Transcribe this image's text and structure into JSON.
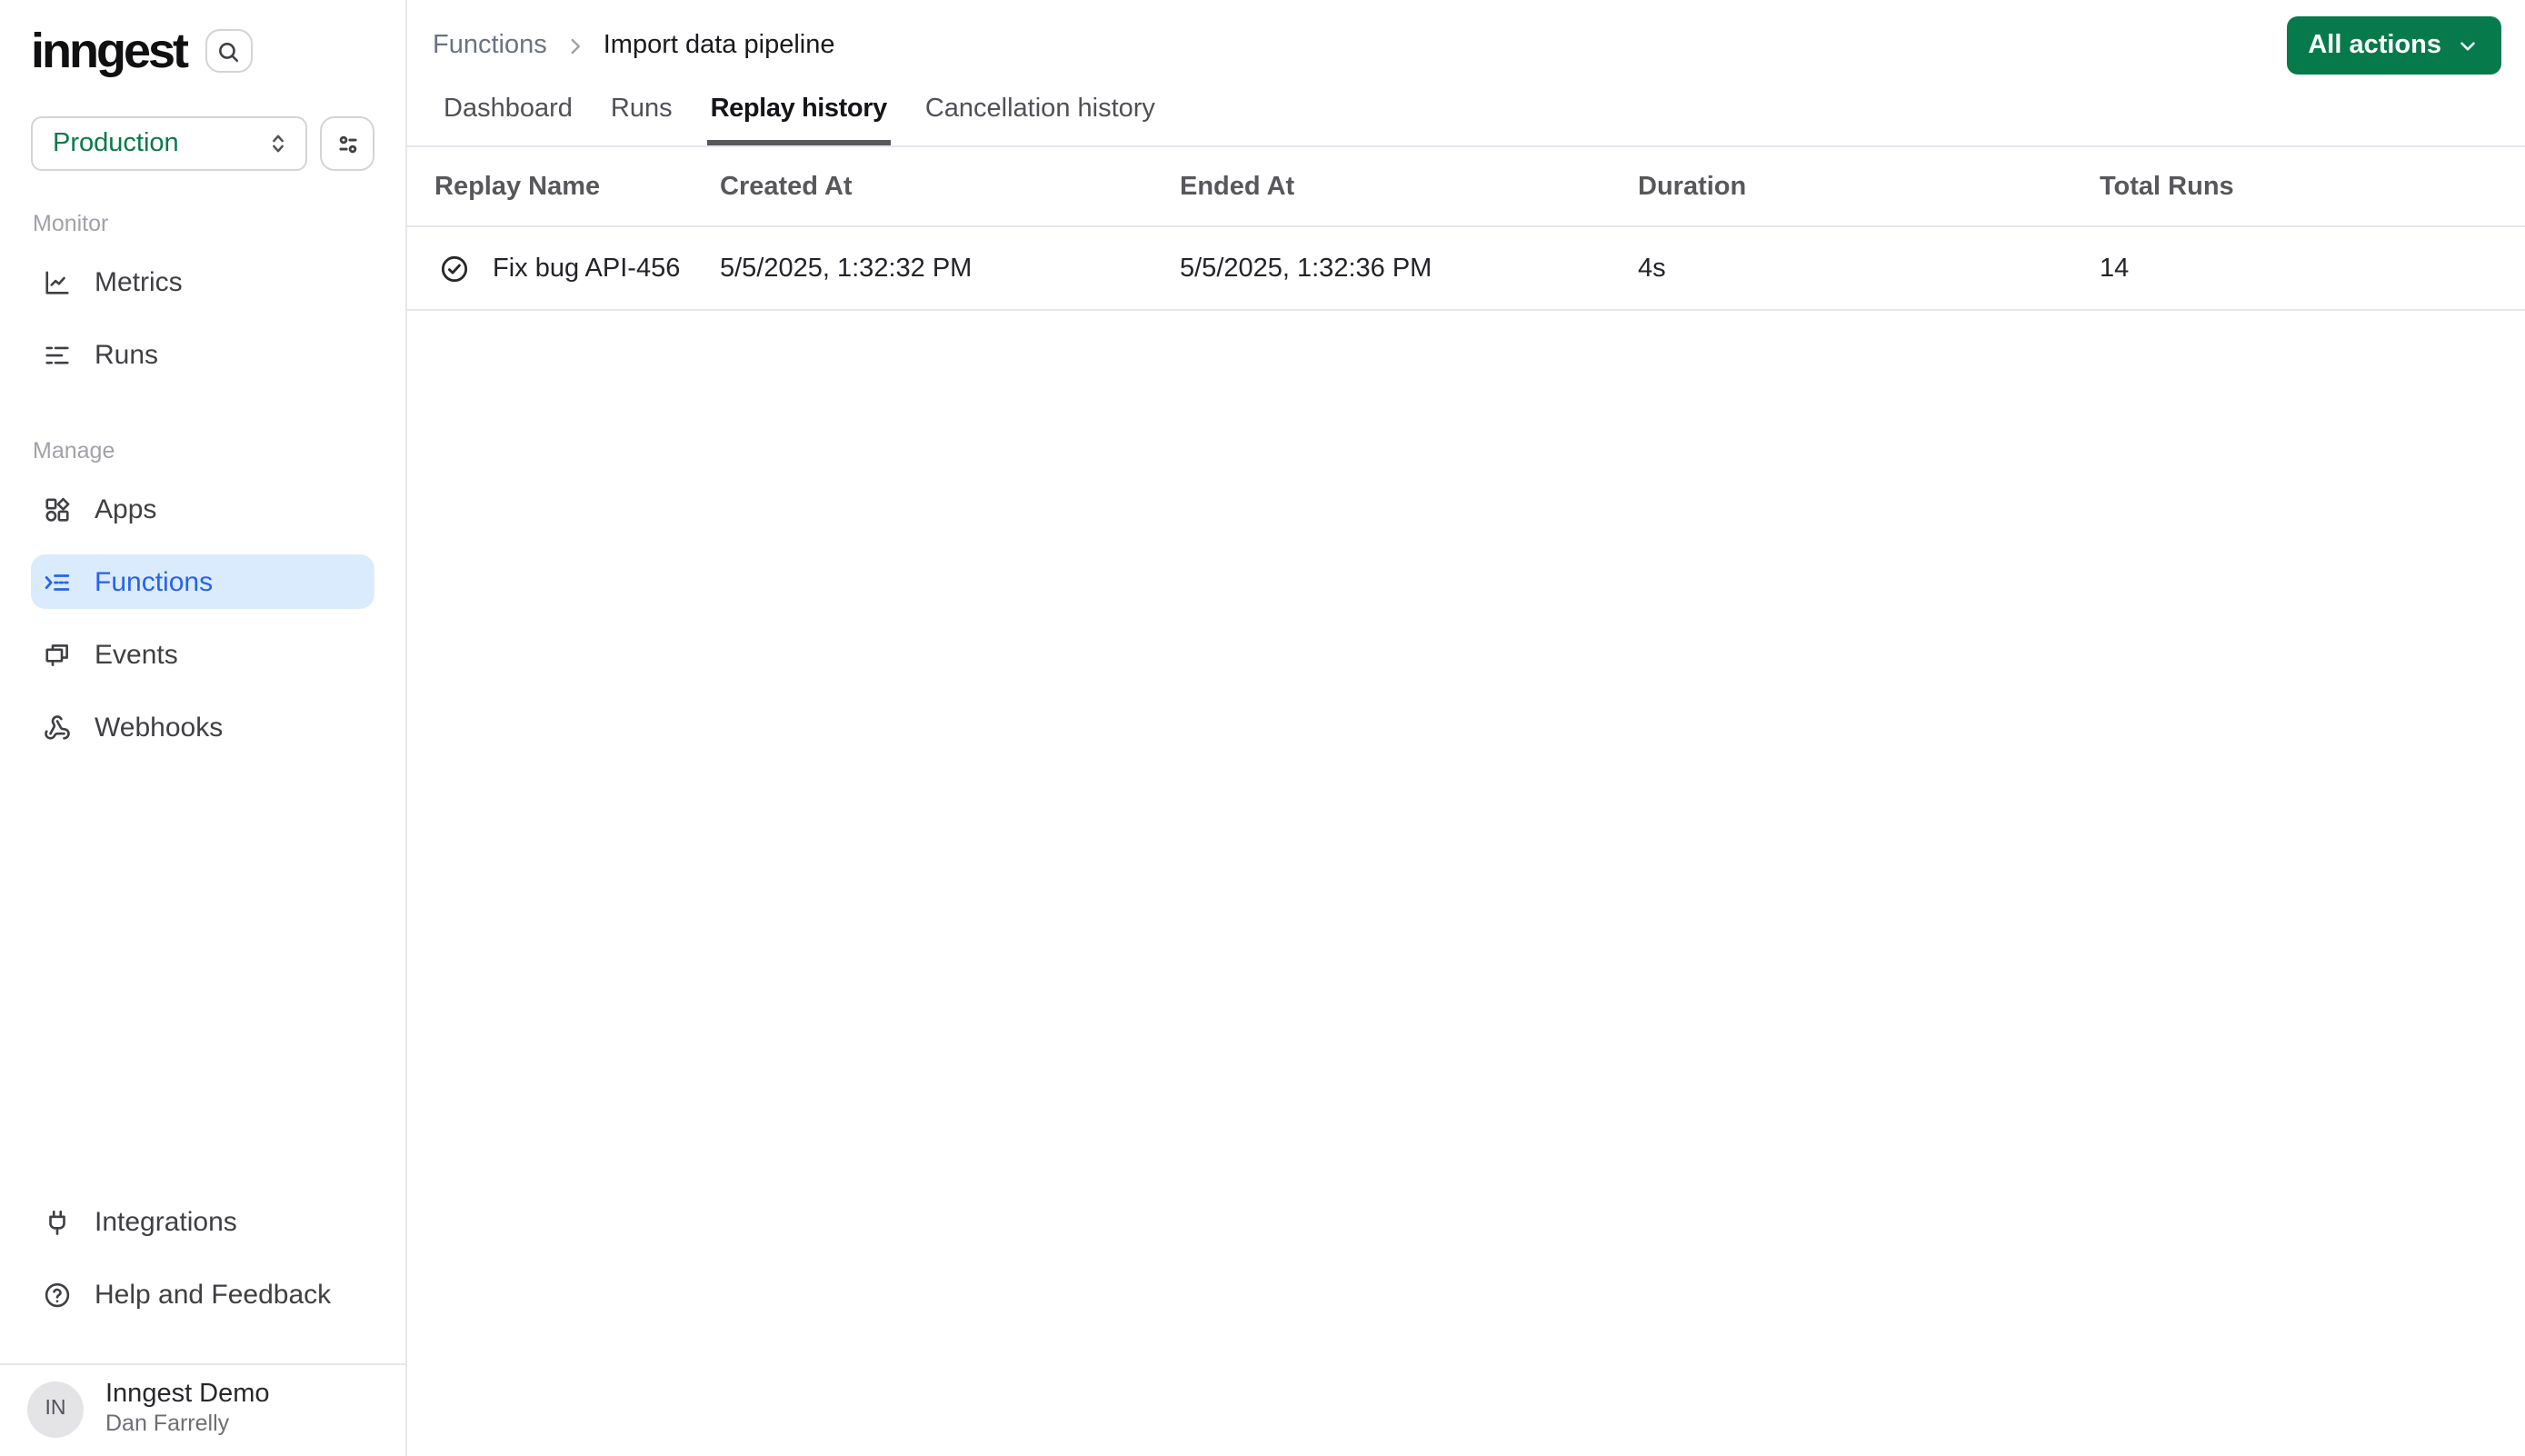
{
  "brand": {
    "logo_text": "inngest"
  },
  "sidebar": {
    "environment": {
      "value": "Production"
    },
    "sections": [
      {
        "label": "Monitor",
        "items": [
          {
            "label": "Metrics",
            "icon": "line-chart-icon"
          },
          {
            "label": "Runs",
            "icon": "list-icon"
          }
        ]
      },
      {
        "label": "Manage",
        "items": [
          {
            "label": "Apps",
            "icon": "apps-shapes-icon"
          },
          {
            "label": "Functions",
            "icon": "function-list-icon",
            "active": true
          },
          {
            "label": "Events",
            "icon": "events-windows-icon"
          },
          {
            "label": "Webhooks",
            "icon": "webhook-icon"
          }
        ]
      }
    ],
    "footer_items": [
      {
        "label": "Integrations",
        "icon": "plug-icon"
      },
      {
        "label": "Help and Feedback",
        "icon": "help-circle-icon"
      }
    ],
    "user": {
      "initials": "IN",
      "org": "Inngest Demo",
      "name": "Dan Farrelly"
    }
  },
  "header": {
    "breadcrumb": {
      "root": "Functions",
      "current": "Import data pipeline"
    },
    "action_button_label": "All actions"
  },
  "tabs": [
    {
      "label": "Dashboard"
    },
    {
      "label": "Runs"
    },
    {
      "label": "Replay history",
      "active": true
    },
    {
      "label": "Cancellation history"
    }
  ],
  "table": {
    "columns": [
      "Replay Name",
      "Created At",
      "Ended At",
      "Duration",
      "Total Runs"
    ],
    "rows": [
      {
        "status_icon": "check-circle-icon",
        "name": "Fix bug API-456",
        "created_at": "5/5/2025, 1:32:32 PM",
        "ended_at": "5/5/2025, 1:32:36 PM",
        "duration": "4s",
        "total_runs": "14"
      }
    ]
  },
  "colors": {
    "accent_green": "#067A4B",
    "active_item_bg": "#DBEBFE",
    "active_item_text": "#2563EB",
    "border": "#E5E7EB",
    "muted_text": "#A1A1AA"
  }
}
